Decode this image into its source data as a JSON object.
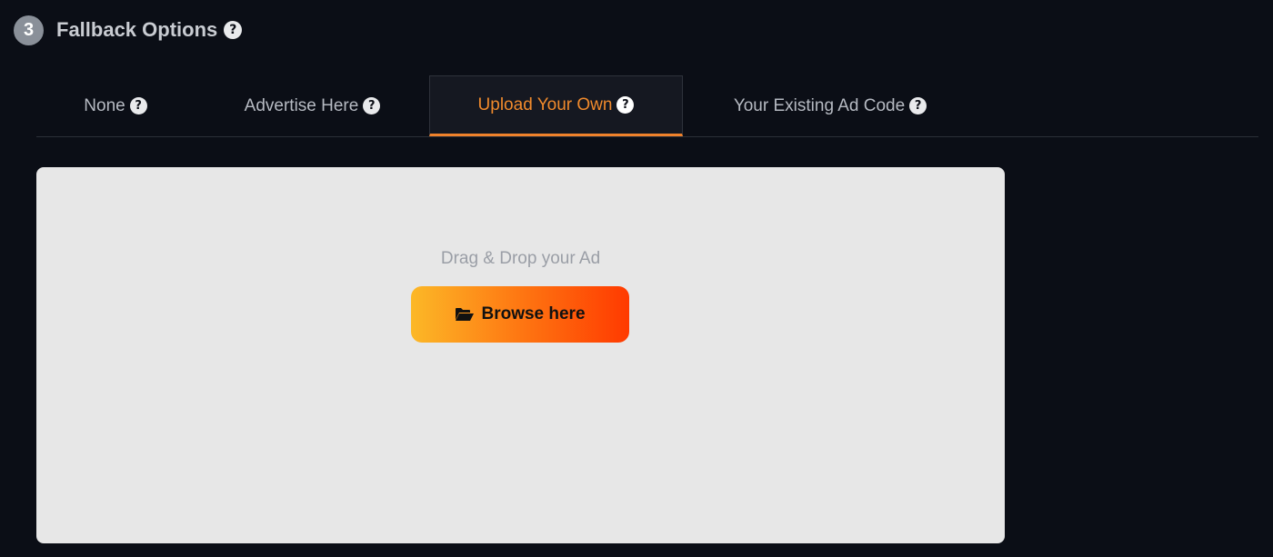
{
  "header": {
    "step_number": "3",
    "title": "Fallback Options",
    "help_glyph": "?"
  },
  "tabs": [
    {
      "label": "None",
      "help_glyph": "?",
      "active": false
    },
    {
      "label": "Advertise Here",
      "help_glyph": "?",
      "active": false
    },
    {
      "label": "Upload Your Own",
      "help_glyph": "?",
      "active": true
    },
    {
      "label": "Your Existing Ad Code",
      "help_glyph": "?",
      "active": false
    }
  ],
  "dropzone": {
    "instruction": "Drag & Drop your Ad",
    "browse_label": "Browse here",
    "browse_icon": "folder-open-icon"
  },
  "colors": {
    "background": "#0b0e16",
    "accent": "#f0822b",
    "dropzone_bg": "#e7e7e7",
    "button_gradient_start": "#fcb827",
    "button_gradient_end": "#ff3a00"
  }
}
